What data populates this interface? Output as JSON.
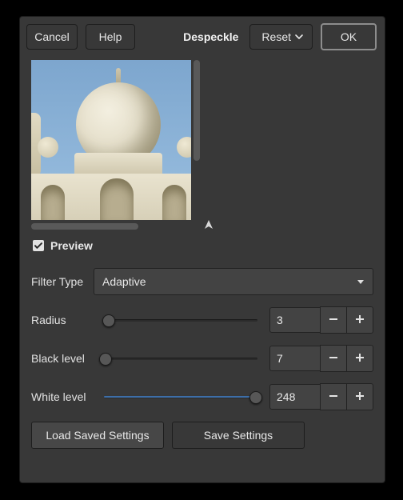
{
  "topbar": {
    "cancel": "Cancel",
    "help": "Help",
    "title": "Despeckle",
    "reset": "Reset",
    "ok": "OK"
  },
  "preview": {
    "checkbox_label": "Preview",
    "checked": true
  },
  "filter": {
    "label": "Filter Type",
    "value": "Adaptive"
  },
  "radius": {
    "label": "Radius",
    "value": "3",
    "pct": 4
  },
  "black": {
    "label": "Black level",
    "value": "7",
    "pct": 2
  },
  "white": {
    "label": "White level",
    "value": "248",
    "pct": 97
  },
  "bottom": {
    "load": "Load Saved Settings",
    "save": "Save Settings"
  }
}
